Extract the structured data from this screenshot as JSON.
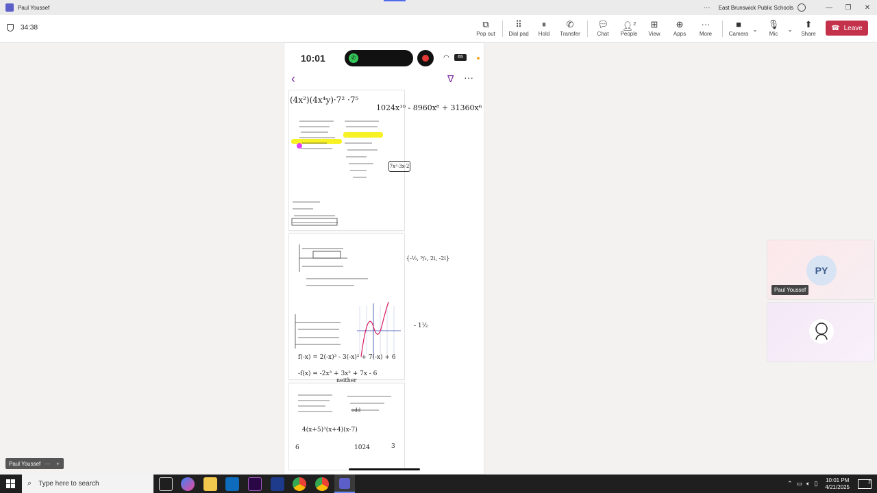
{
  "window": {
    "title": "Paul Youssef",
    "org": "East Brunswick Public Schools",
    "controls": {
      "minimize": "—",
      "restore": "❐",
      "close": "✕"
    }
  },
  "meeting": {
    "timer": "34:38"
  },
  "toolbar": {
    "pop_out": "Pop out",
    "dial_pad": "Dial pad",
    "hold": "Hold",
    "transfer": "Transfer",
    "chat": "Chat",
    "people": "People",
    "people_count": "2",
    "view": "View",
    "apps": "Apps",
    "more": "More",
    "camera": "Camera",
    "mic": "Mic",
    "share": "Share",
    "leave": "Leave"
  },
  "phone": {
    "time": "10:01",
    "battery": "65"
  },
  "worksheet": {
    "line1": "(4x²)(4x⁴y)·7² ·7⁵",
    "line1b": "1024x¹⁰ - 8960x⁸ + 31360x⁶",
    "box1": "7x²-3x-2",
    "set1": "{-½, ⁹/₂, 2i, -2i}",
    "mark1": "- 1½",
    "fx1": "f(-x) = 2(-x)³ - 3(-x)² + 7(-x) + 6",
    "fx2": "-f(x) = -2x³ + 3x² + 7x - 6",
    "label_neither": "neither",
    "label_odd": "odd",
    "factor": "4(x+5)³(x+4)(x-7)",
    "num1": "6",
    "num2": "1024",
    "num3": "3"
  },
  "participants": [
    {
      "initials": "PY",
      "name": "Paul Youssef"
    },
    {
      "initials": "",
      "name": ""
    }
  ],
  "self_view": {
    "name": "Paul Youssef"
  },
  "taskbar": {
    "search_placeholder": "Type here to search",
    "time": "10:01 PM",
    "date": "4/21/2025",
    "notifications": "2"
  }
}
